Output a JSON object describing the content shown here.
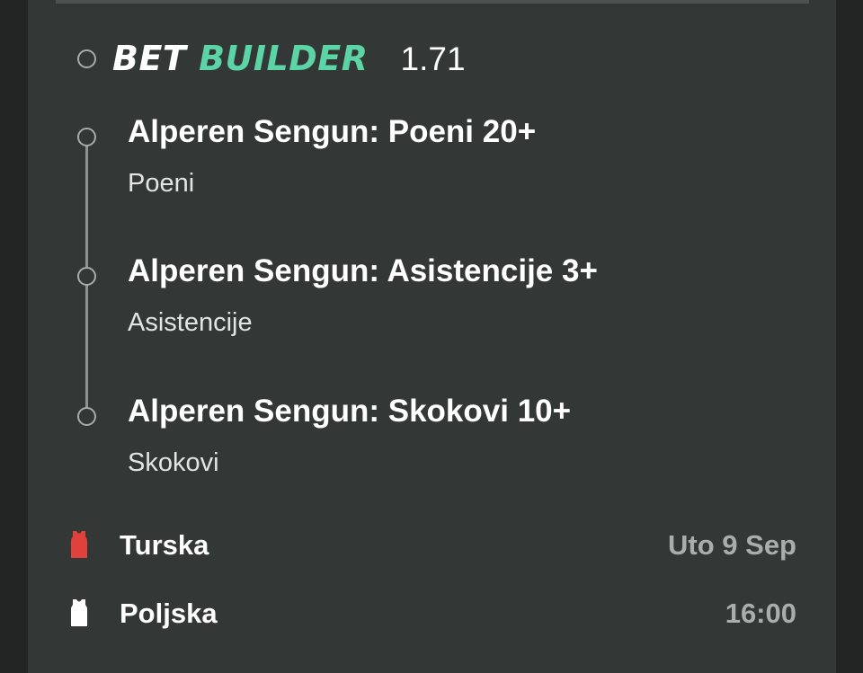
{
  "bet_builder": {
    "label_part1": "BET",
    "label_part2": "BUILDER",
    "odds": "1.71"
  },
  "legs": [
    {
      "title": "Alperen Sengun: Poeni 20+",
      "market": "Poeni"
    },
    {
      "title": "Alperen Sengun: Asistencije 3+",
      "market": "Asistencije"
    },
    {
      "title": "Alperen Sengun: Skokovi 10+",
      "market": "Skokovi"
    }
  ],
  "match": {
    "home_team": "Turska",
    "away_team": "Poljska",
    "date": "Uto 9 Sep",
    "time": "16:00",
    "home_jersey_icon": "jersey-red-icon",
    "away_jersey_icon": "jersey-white-icon"
  },
  "colors": {
    "accent_green": "#5cd4a6",
    "card_bg": "#333735",
    "home_jersey": "#e0413a",
    "away_jersey": "#ffffff"
  }
}
